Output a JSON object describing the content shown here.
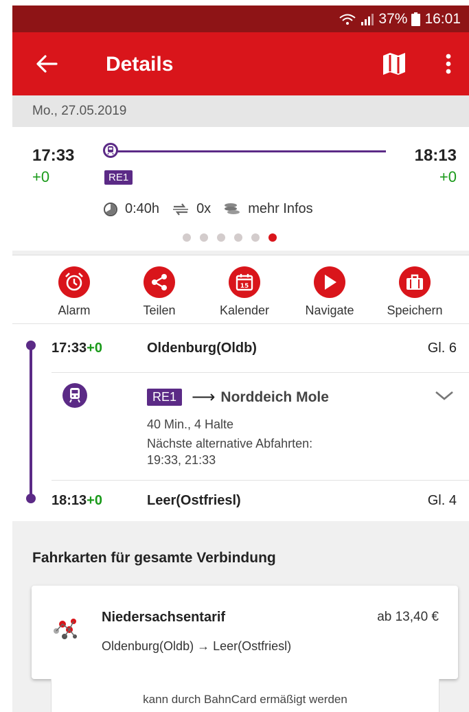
{
  "status_bar": {
    "battery": "37%",
    "time": "16:01"
  },
  "app_bar": {
    "title": "Details"
  },
  "date": "Mo., 27.05.2019",
  "summary": {
    "dep_time": "17:33",
    "dep_delay": "+0",
    "arr_time": "18:13",
    "arr_delay": "+0",
    "line": "RE1",
    "duration": "0:40h",
    "changes": "0x",
    "more": "mehr Infos",
    "pages": 6,
    "active_page": 6
  },
  "actions": [
    {
      "label": "Alarm",
      "icon": "alarm-clock-icon"
    },
    {
      "label": "Teilen",
      "icon": "share-icon"
    },
    {
      "label": "Kalender",
      "icon": "calendar-icon"
    },
    {
      "label": "Navigate",
      "icon": "play-icon"
    },
    {
      "label": "Speichern",
      "icon": "briefcase-icon"
    }
  ],
  "journey": {
    "from": {
      "time": "17:33",
      "delay": "+0",
      "station": "Oldenburg(Oldb)",
      "platform": "Gl. 6"
    },
    "leg": {
      "line": "RE1",
      "arrow": "⟶",
      "destination": "Norddeich Mole",
      "duration_stops": "40 Min., 4 Halte",
      "alt_label": "Nächste alternative Abfahrten:",
      "alt_times": "19:33, 21:33"
    },
    "to": {
      "time": "18:13",
      "delay": "+0",
      "station": "Leer(Ostfriesl)",
      "platform": "Gl. 4"
    }
  },
  "tickets": {
    "title": "Fahrkarten für gesamte Verbindung",
    "ticket": {
      "name": "Niedersachsentarif",
      "price": "ab 13,40 €",
      "route": "Oldenburg(Oldb) → Leer(Ostfriesl)"
    },
    "bahncard_note": "kann durch BahnCard ermäßigt werden"
  },
  "colors": {
    "accent": "#d9151b",
    "status": "#8e1416",
    "line": "#5b2a86",
    "ontime": "#1a9a1a"
  }
}
